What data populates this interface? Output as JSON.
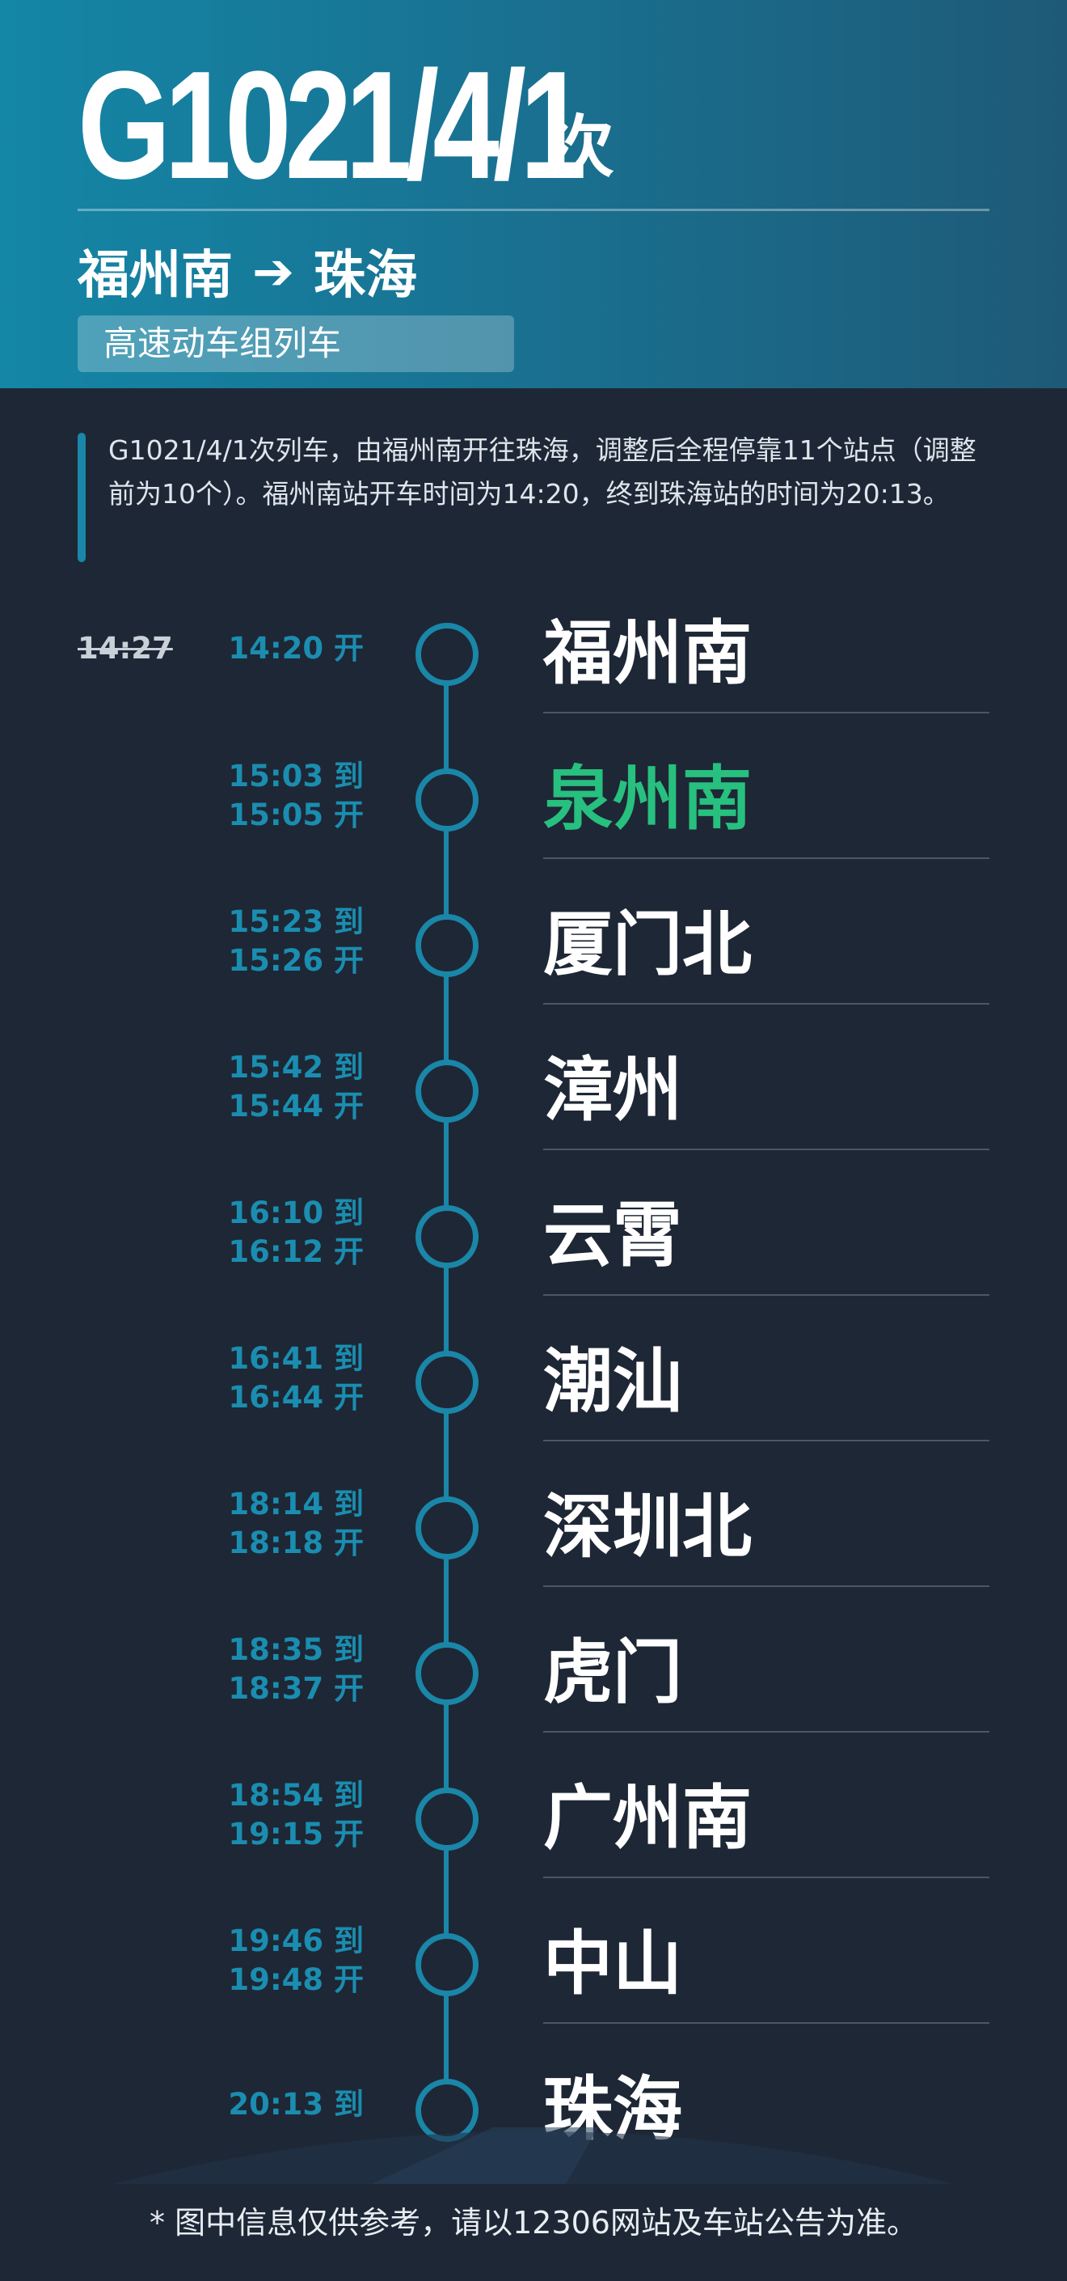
{
  "header": {
    "train_number": "G1021/4/1",
    "train_suffix": "次",
    "origin": "福州南",
    "arrow": "➔",
    "destination": "珠海",
    "train_type": "高速动车组列车"
  },
  "description": "G1021/4/1次列车，由福州南开往珠海，调整后全程停靠11个站点（调整前为10个）。福州南站开车时间为14:20，终到珠海站的时间为20:13。",
  "stops": [
    {
      "name": "福州南",
      "times": [
        "14:20 开"
      ],
      "original_time": "14:27"
    },
    {
      "name": "泉州南",
      "times": [
        "15:03 到",
        "15:05 开"
      ],
      "highlight": true
    },
    {
      "name": "厦门北",
      "times": [
        "15:23 到",
        "15:26 开"
      ]
    },
    {
      "name": "漳州",
      "times": [
        "15:42 到",
        "15:44 开"
      ]
    },
    {
      "name": "云霄",
      "times": [
        "16:10 到",
        "16:12 开"
      ]
    },
    {
      "name": "潮汕",
      "times": [
        "16:41 到",
        "16:44 开"
      ]
    },
    {
      "name": "深圳北",
      "times": [
        "18:14 到",
        "18:18 开"
      ]
    },
    {
      "name": "虎门",
      "times": [
        "18:35 到",
        "18:37 开"
      ]
    },
    {
      "name": "广州南",
      "times": [
        "18:54 到",
        "19:15 开"
      ]
    },
    {
      "name": "中山",
      "times": [
        "19:46 到",
        "19:48 开"
      ]
    },
    {
      "name": "珠海",
      "times": [
        "20:13 到"
      ]
    }
  ],
  "footnote": "* 图中信息仅供参考，请以12306网站及车站公告为准。",
  "colors": {
    "background": "#1e2735",
    "header_start": "#1486a6",
    "header_end": "#1e5a78",
    "accent": "#1a86a8",
    "highlight_station": "#27c07f"
  }
}
